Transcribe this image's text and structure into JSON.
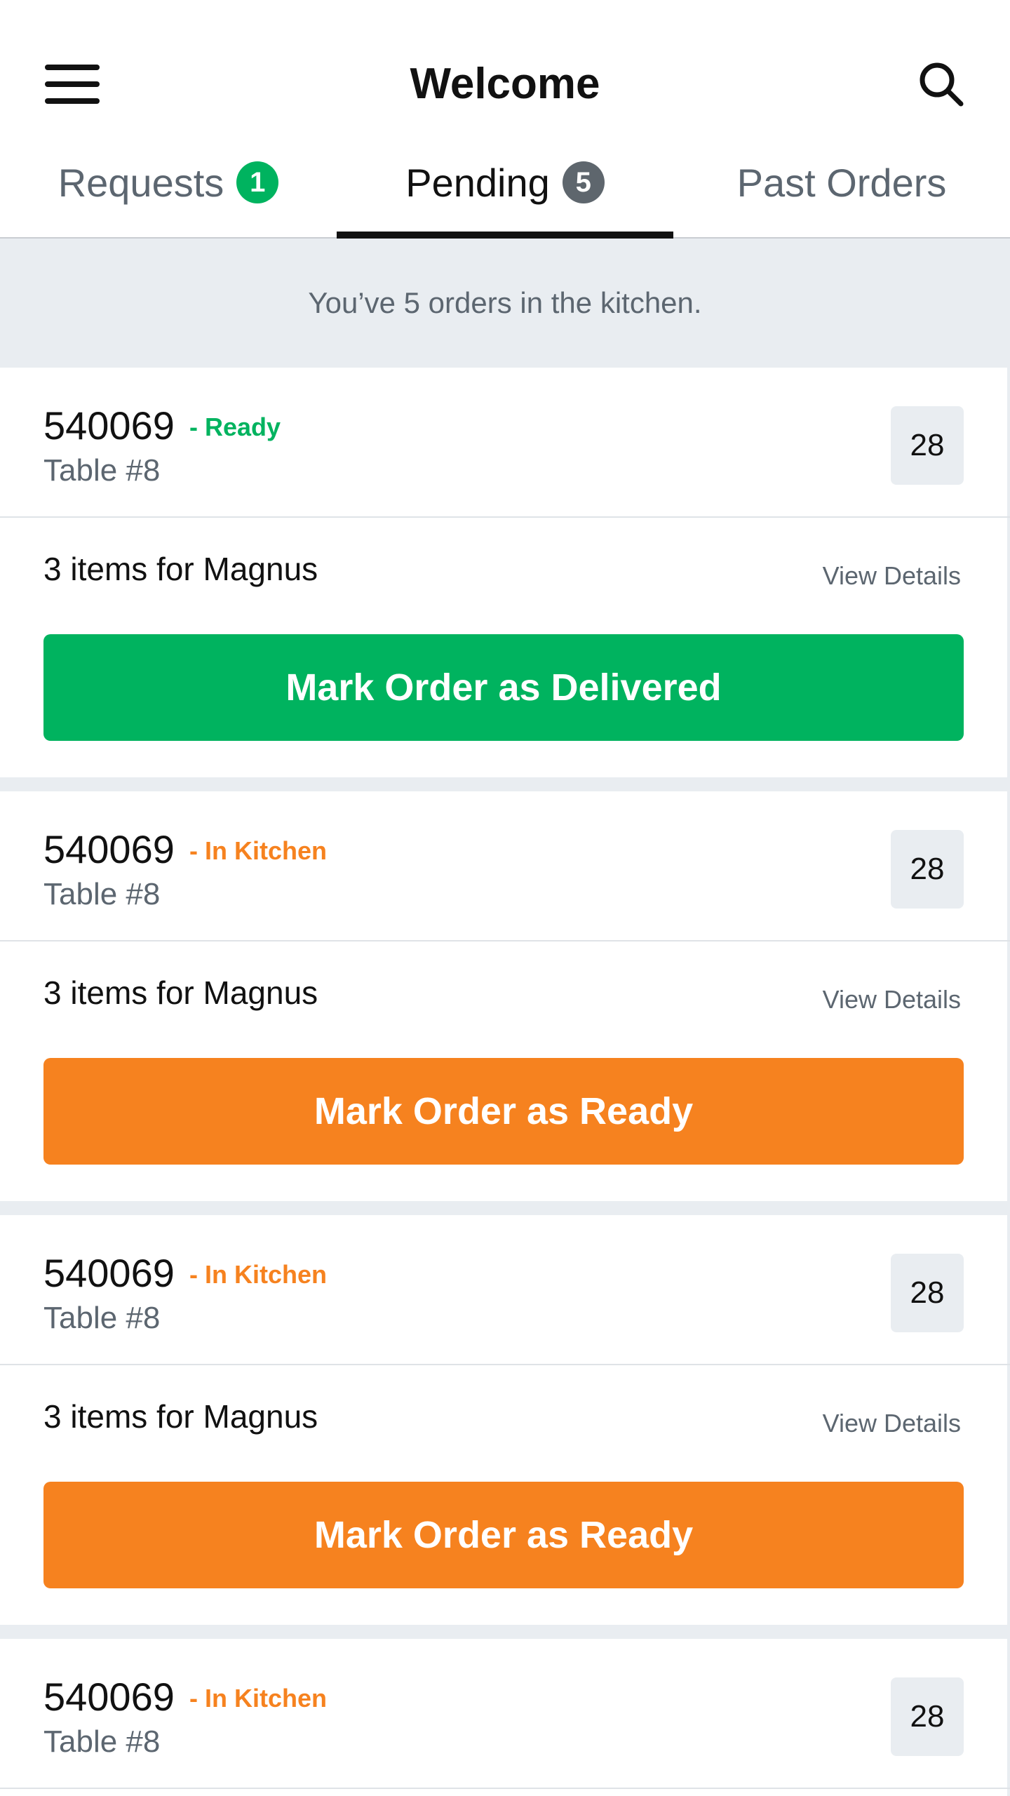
{
  "header": {
    "title": "Welcome",
    "menu_icon": "hamburger-menu-icon",
    "search_icon": "search-icon"
  },
  "tabs": [
    {
      "label": "Requests",
      "badge": "1",
      "active": false
    },
    {
      "label": "Pending",
      "badge": "5",
      "active": true
    },
    {
      "label": "Past Orders",
      "badge": null,
      "active": false
    }
  ],
  "info_text": "You’ve 5 orders in the kitchen.",
  "colors": {
    "green": "#00b35f",
    "orange": "#f6821f",
    "gray_badge": "#5e666d",
    "background_gray": "#e9edf1"
  },
  "orders": [
    {
      "order_id": "540069",
      "status": "- Ready",
      "table": "Table #8",
      "count": "28",
      "items_text": "3 items for Magnus",
      "details_link": "View Details",
      "action_label": "Mark Order as Delivered"
    },
    {
      "order_id": "540069",
      "status": "- In Kitchen",
      "table": "Table #8",
      "count": "28",
      "items_text": "3 items for Magnus",
      "details_link": "View Details",
      "action_label": "Mark Order as Ready"
    },
    {
      "order_id": "540069",
      "status": "- In Kitchen",
      "table": "Table #8",
      "count": "28",
      "items_text": "3 items for Magnus",
      "details_link": "View Details",
      "action_label": "Mark Order as Ready"
    },
    {
      "order_id": "540069",
      "status": "- In Kitchen",
      "table": "Table #8",
      "count": "28"
    }
  ]
}
